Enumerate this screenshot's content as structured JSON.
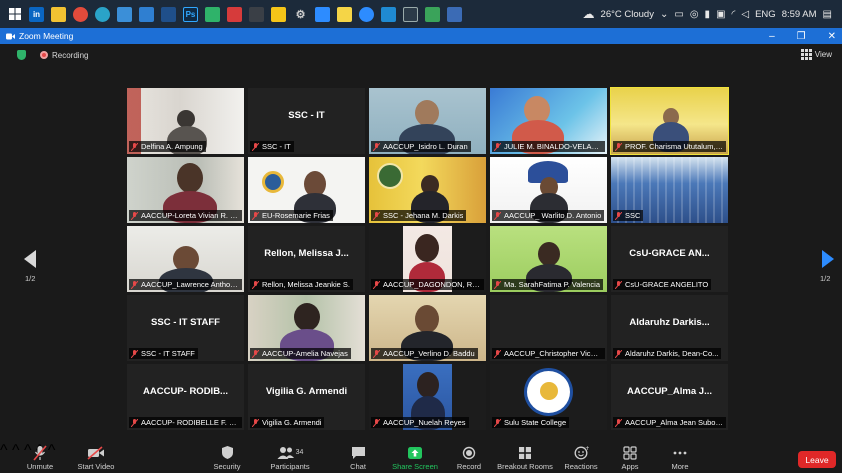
{
  "taskbar": {
    "weather": "26°C  Cloudy",
    "language": "ENG",
    "time": "8:59 AM"
  },
  "window": {
    "title": "Zoom Meeting"
  },
  "meeting": {
    "recording_label": "Recording",
    "view_label": "View",
    "page_left": "1/2",
    "page_right": "1/2"
  },
  "tiles": [
    {
      "label": "Delfina A. Ampung",
      "center": ""
    },
    {
      "label": "SSC - IT",
      "center": "SSC - IT"
    },
    {
      "label": "AACCUP_Isidro L. Duran",
      "center": ""
    },
    {
      "label": "JULIE M. BINALDO-VELASC...",
      "center": ""
    },
    {
      "label": "PROF. Charisma Ututalum, CESE",
      "center": ""
    },
    {
      "label": "AACCUP-Loreta Vivian R. Gu...",
      "center": ""
    },
    {
      "label": "EU-Rosemarie Frias",
      "center": ""
    },
    {
      "label": "SSC - Jehana M. Darkis",
      "center": ""
    },
    {
      "label": "AACCUP_ Warlito D. Antonio",
      "center": ""
    },
    {
      "label": "SSC",
      "center": ""
    },
    {
      "label": "AACCUP_Lawrence Anthony...",
      "center": ""
    },
    {
      "label": "Rellon, Melissa Jeankie S.",
      "center": "Rellon, Melissa J..."
    },
    {
      "label": "AACCUP_DAGONDON, RO...",
      "center": ""
    },
    {
      "label": "Ma. SarahFatima P. Valencia",
      "center": ""
    },
    {
      "label": "CsU-GRACE ANGELITO",
      "center": "CsU-GRACE AN..."
    },
    {
      "label": "SSC - IT STAFF",
      "center": "SSC - IT STAFF"
    },
    {
      "label": "AACCUP-Amelia Navejas",
      "center": ""
    },
    {
      "label": "AACCUP_Verlino D. Baddu",
      "center": ""
    },
    {
      "label": "AACCUP_Christopher Vicen...",
      "center": ""
    },
    {
      "label": "Aldaruhz Darkis, Dean-Co...",
      "center": "Aldaruhz Darkis..."
    },
    {
      "label": "AACCUP- RODIBELLE F. LE...",
      "center": "AACCUP- RODIB..."
    },
    {
      "label": "Vigilia G. Armendi",
      "center": "Vigilia G. Armendi"
    },
    {
      "label": "AACCUP_Nuelah Reyes",
      "center": ""
    },
    {
      "label": "Sulu State College",
      "center": ""
    },
    {
      "label": "AACCUP_Alma Jean Subong",
      "center": "AACCUP_Alma J..."
    }
  ],
  "toolbar": {
    "unmute": "Unmute",
    "start_video": "Start Video",
    "security": "Security",
    "participants": "Participants",
    "participant_count": "34",
    "chat": "Chat",
    "share_screen": "Share Screen",
    "record": "Record",
    "breakout_rooms": "Breakout Rooms",
    "reactions": "Reactions",
    "apps": "Apps",
    "more": "More",
    "leave": "Leave"
  },
  "colors": {
    "title_bar": "#1d6fd6",
    "active_speaker": "#f0e33a",
    "leave": "#e02828",
    "share_screen": "#22c55e",
    "muted_mic": "#e64848"
  }
}
